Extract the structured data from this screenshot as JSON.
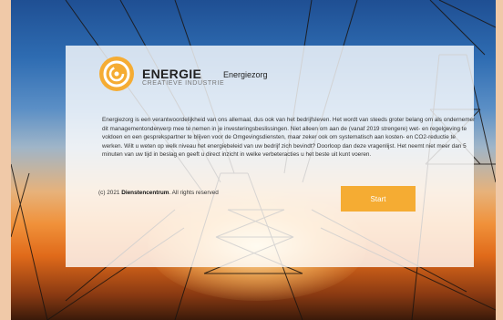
{
  "brand": {
    "name": "ENERGIE",
    "subtitle": "CREATIEVE INDUSTRIE",
    "logo_icon": "swirl-logo-icon",
    "accent": "#f5ac33"
  },
  "heading": "Energiezorg",
  "intro_text": "Energiezorg is een verantwoordelijkheid van ons allemaal, dus ook van het bedrijfsleven. Het wordt van steeds groter belang om als ondernemer dit managementonderwerp mee te nemen in je investeringsbeslissingen. Niet alleen om aan de (vanaf 2019 strengere) wet- en regelgeving te voldoen en een gesprekspartner te blijven voor de Omgevingsdiensten, maar zeker ook om systematisch aan kosten- en CO2-reductie te werken. Wilt u weten op welk niveau het energiebeleid van uw bedrijf zich bevindt? Doorloop dan deze vragenlijst. Het neemt niet meer dan 5 minuten van uw tijd in beslag en geeft u direct inzicht in welke verbeteracties u het beste uit kunt voeren.",
  "footer": {
    "prefix": "(c) 2021 ",
    "company": "Dienstencentrum",
    "suffix": ". All rights reserved"
  },
  "start_button": {
    "label": "Start",
    "color": "#f5ac33"
  }
}
